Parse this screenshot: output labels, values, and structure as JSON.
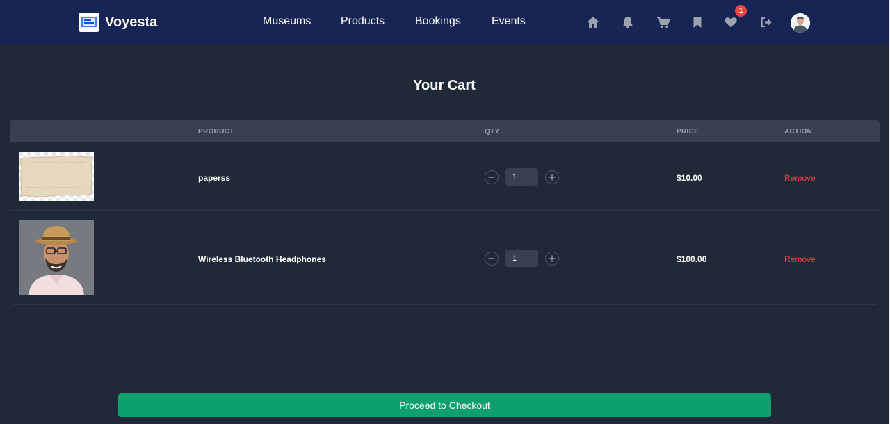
{
  "brand": {
    "name": "Voyesta"
  },
  "nav": {
    "links": [
      "Museums",
      "Products",
      "Bookings",
      "Events"
    ],
    "icons": [
      "home-icon",
      "bell-icon",
      "cart-icon",
      "bookmark-icon",
      "heart-icon",
      "logout-icon"
    ],
    "wishlist_badge": "1"
  },
  "cart": {
    "title": "Your Cart",
    "headers": {
      "product": "PRODUCT",
      "qty": "QTY",
      "price": "PRICE",
      "action": "ACTION"
    },
    "items": [
      {
        "name": "paperss",
        "qty": "1",
        "price": "$10.00",
        "action": "Remove"
      },
      {
        "name": "Wireless Bluetooth Headphones",
        "qty": "1",
        "price": "$100.00",
        "action": "Remove"
      }
    ],
    "checkout_label": "Proceed to Checkout"
  },
  "colors": {
    "navbar": "#172554",
    "background": "#1f2937",
    "table_header": "#374151",
    "checkout": "#0d9f6e",
    "remove": "#ef4444",
    "badge": "#ef4444"
  }
}
